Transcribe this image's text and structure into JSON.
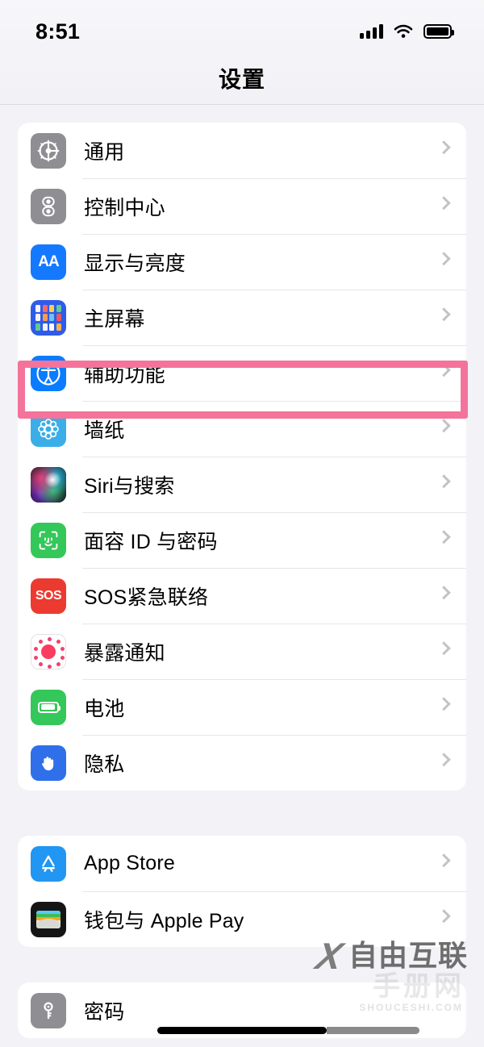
{
  "status_bar": {
    "time": "8:51",
    "signal_icon": "cellular-bars-icon",
    "wifi_icon": "wifi-icon",
    "battery_icon": "battery-full-icon"
  },
  "nav": {
    "title": "设置"
  },
  "highlight": {
    "target": "辅助功能",
    "color": "#F4739B"
  },
  "groups": [
    {
      "id": "group-main",
      "items": [
        {
          "label": "通用",
          "icon": "gear-icon",
          "icon_class": "ic-general",
          "chevron": true
        },
        {
          "label": "控制中心",
          "icon": "toggles-icon",
          "icon_class": "ic-control",
          "chevron": true
        },
        {
          "label": "显示与亮度",
          "icon": "aa-text-icon",
          "icon_class": "ic-display",
          "chevron": true
        },
        {
          "label": "主屏幕",
          "icon": "home-screen-icon",
          "icon_class": "ic-home",
          "chevron": true
        },
        {
          "label": "辅助功能",
          "icon": "accessibility-icon",
          "icon_class": "ic-access",
          "chevron": true
        },
        {
          "label": "墙纸",
          "icon": "wallpaper-icon",
          "icon_class": "ic-wallpaper",
          "chevron": true
        },
        {
          "label": "Siri与搜索",
          "icon": "siri-icon",
          "icon_class": "ic-siri",
          "chevron": true
        },
        {
          "label": "面容 ID 与密码",
          "icon": "face-id-icon",
          "icon_class": "ic-faceid",
          "chevron": true
        },
        {
          "label": "SOS紧急联络",
          "icon": "sos-icon",
          "icon_class": "ic-sos",
          "chevron": true
        },
        {
          "label": "暴露通知",
          "icon": "exposure-notification-icon",
          "icon_class": "ic-expose",
          "chevron": true
        },
        {
          "label": "电池",
          "icon": "battery-icon",
          "icon_class": "ic-battery",
          "chevron": true
        },
        {
          "label": "隐私",
          "icon": "privacy-hand-icon",
          "icon_class": "ic-privacy",
          "chevron": true
        }
      ]
    },
    {
      "id": "group-store",
      "items": [
        {
          "label": "App Store",
          "icon": "app-store-icon",
          "icon_class": "ic-appstore",
          "chevron": true
        },
        {
          "label": "钱包与 Apple Pay",
          "icon": "wallet-icon",
          "icon_class": "ic-wallet",
          "chevron": true
        }
      ]
    },
    {
      "id": "group-passwords",
      "items": [
        {
          "label": "密码",
          "icon": "key-icon",
          "icon_class": "ic-password",
          "chevron": false
        }
      ]
    }
  ],
  "icon_glyphs": {
    "display": "AA",
    "sos": "SOS"
  },
  "watermark": {
    "logo": "X",
    "brand": "自由互联",
    "ghost_text": "手册网",
    "url": "SHOUCESHI.COM"
  }
}
